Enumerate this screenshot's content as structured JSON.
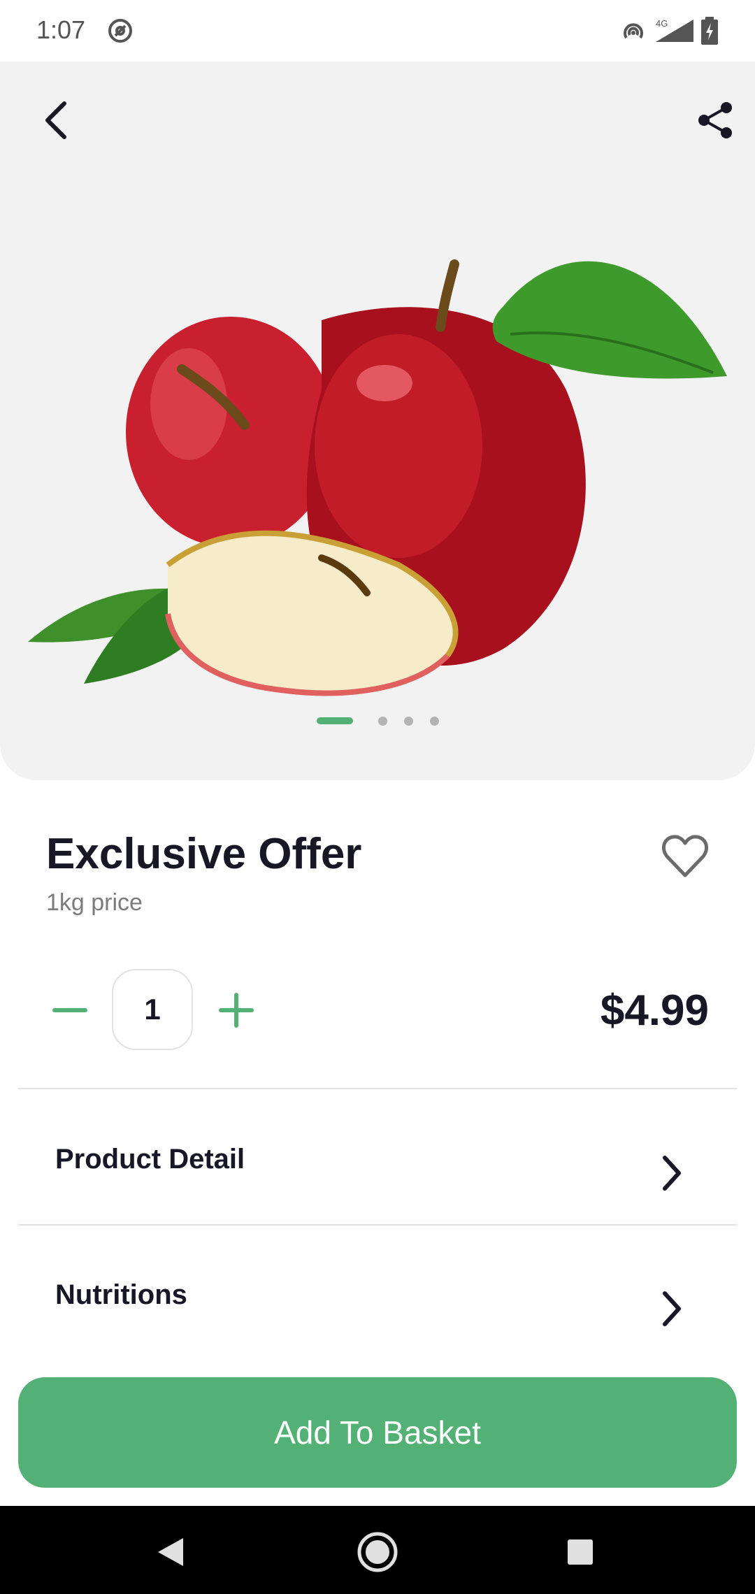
{
  "status_bar": {
    "time": "1:07"
  },
  "hero": {
    "pager_count": 4,
    "pager_active": 0
  },
  "product": {
    "title": "Exclusive Offer",
    "subtitle": "1kg price",
    "quantity": "1",
    "price": "$4.99"
  },
  "sections": [
    {
      "label": "Product Detail"
    },
    {
      "label": "Nutritions"
    }
  ],
  "cta": {
    "label": "Add To Basket"
  },
  "colors": {
    "accent": "#53b175",
    "text": "#181725",
    "muted": "#7c7c7c",
    "hero_bg": "#f2f2f2"
  },
  "icons": {
    "back": "back-arrow-icon",
    "share": "share-icon",
    "favorite": "heart-outline-icon",
    "minus": "minus-icon",
    "plus": "plus-icon",
    "chevron": "chevron-right-icon"
  }
}
